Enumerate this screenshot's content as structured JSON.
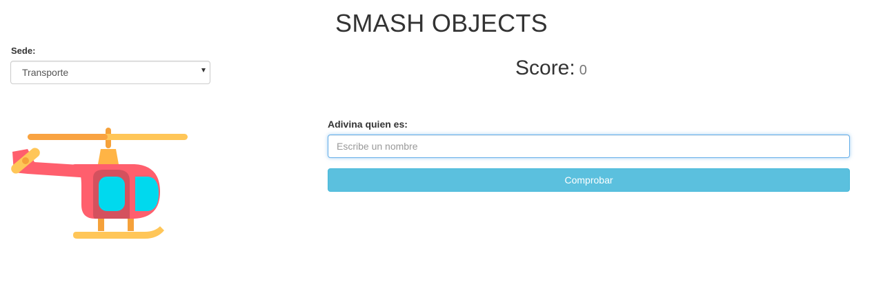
{
  "header": {
    "title": "SMASH OBJECTS"
  },
  "category": {
    "label": "Sede:",
    "selected": "Transporte"
  },
  "score": {
    "label": "Score:",
    "value": "0"
  },
  "guess": {
    "label": "Adivina quien es:",
    "placeholder": "Escribe un nombre",
    "value": "",
    "button_label": "Comprobar"
  },
  "image": {
    "icon": "helicopter-icon"
  },
  "colors": {
    "button": "#5bc0de",
    "input_focus": "#66afe9",
    "helicopter_body": "#ff5f6d",
    "helicopter_window": "#00d9ee",
    "helicopter_rotor": "#ffc658"
  }
}
